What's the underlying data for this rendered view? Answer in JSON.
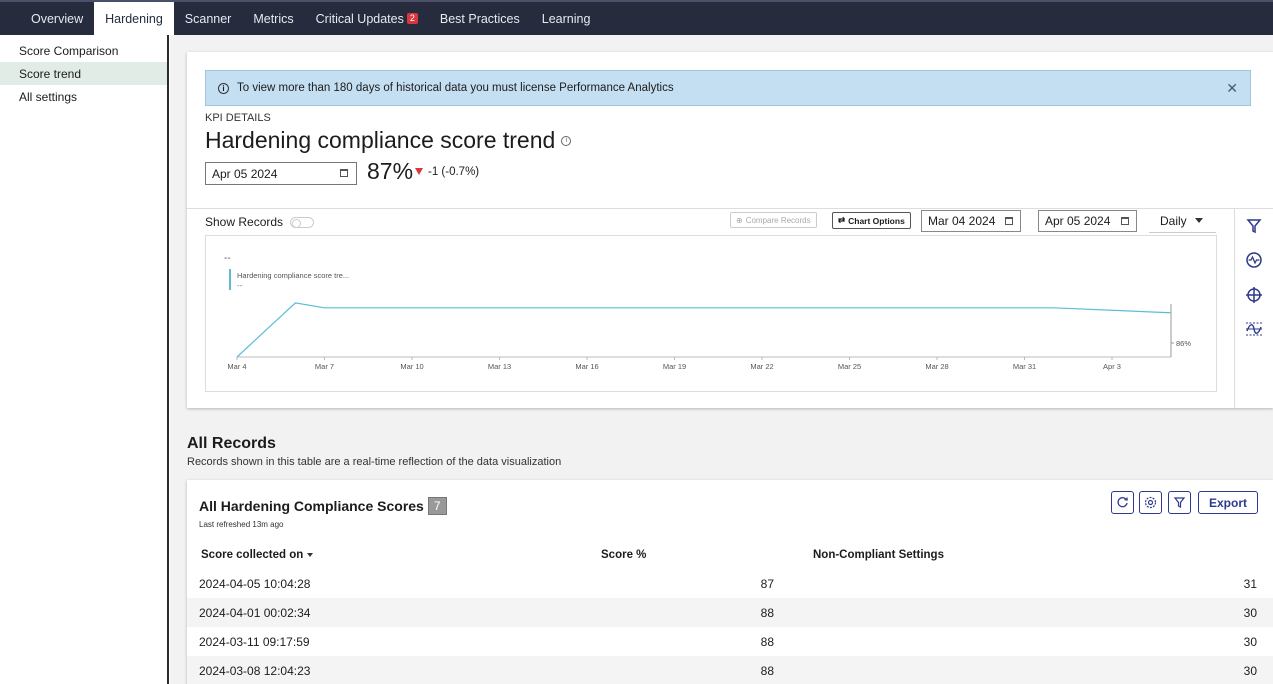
{
  "nav": {
    "tabs": [
      {
        "label": "Overview"
      },
      {
        "label": "Hardening"
      },
      {
        "label": "Scanner"
      },
      {
        "label": "Metrics"
      },
      {
        "label": "Critical Updates",
        "badge": "2"
      },
      {
        "label": "Best Practices"
      },
      {
        "label": "Learning"
      }
    ],
    "active_tab": "Hardening"
  },
  "sidebar": {
    "items": [
      {
        "label": "Score Comparison"
      },
      {
        "label": "Score trend"
      },
      {
        "label": "All settings"
      }
    ],
    "active_item": "Score trend"
  },
  "banner": {
    "text": "To view more than 180 days of historical data you must license Performance Analytics",
    "close_icon": "close-icon",
    "info_icon": "info-icon"
  },
  "kpi": {
    "label": "KPI DETAILS",
    "title": "Hardening compliance score trend",
    "date": "Apr 05 2024",
    "value": "87%",
    "change": "-1 (-0.7%)",
    "change_color": "#d9363e"
  },
  "toolbar": {
    "show_records": "Show Records",
    "compare_records": "Compare Records",
    "chart_options": "Chart Options",
    "start_date": "Mar 04 2024",
    "end_date": "Apr 05 2024",
    "frequency": "Daily"
  },
  "chart_data": {
    "type": "line",
    "legend": "Hardening compliance score tre...",
    "legend_value": "--",
    "top_label": "--",
    "series_color": "#5bbcd6",
    "x_ticks": [
      "Mar 4",
      "Mar 7",
      "Mar 10",
      "Mar 13",
      "Mar 16",
      "Mar 19",
      "Mar 22",
      "Mar 25",
      "Mar 28",
      "Mar 31",
      "Apr 3"
    ],
    "y_tick_label": "86%",
    "x": [
      "2024-03-04",
      "2024-03-06",
      "2024-03-07",
      "2024-04-01",
      "2024-04-05"
    ],
    "y": [
      78,
      89,
      88,
      88,
      87
    ],
    "ylim": [
      78,
      90
    ]
  },
  "side_tools": [
    "filter-icon",
    "pulse-icon",
    "crosshair-icon",
    "threshold-icon"
  ],
  "records": {
    "title": "All Records",
    "subtitle": "Records shown in this table are a real-time reflection of the data visualization",
    "table_title": "All Hardening Compliance Scores",
    "count": "7",
    "refreshed": "Last refreshed 13m ago",
    "export_label": "Export",
    "columns": [
      "Score collected on",
      "Score %",
      "Non-Compliant Settings"
    ],
    "rows": [
      {
        "date": "2024-04-05 10:04:28",
        "score": "87",
        "noncompliant": "31"
      },
      {
        "date": "2024-04-01 00:02:34",
        "score": "88",
        "noncompliant": "30"
      },
      {
        "date": "2024-03-11 09:17:59",
        "score": "88",
        "noncompliant": "30"
      },
      {
        "date": "2024-03-08 12:04:23",
        "score": "88",
        "noncompliant": "30"
      }
    ]
  }
}
